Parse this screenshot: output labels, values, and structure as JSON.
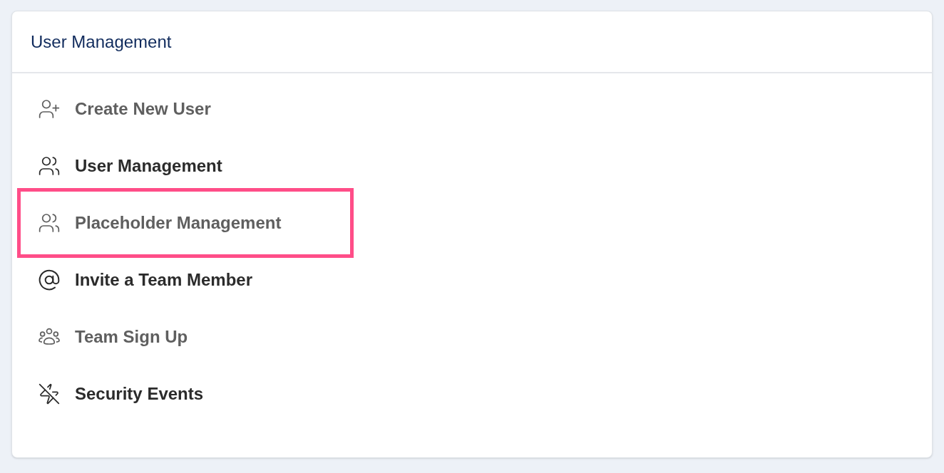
{
  "card": {
    "title": "User Management"
  },
  "menu": [
    {
      "label": "Create New User",
      "kind": "add-user",
      "dimmed": true,
      "highlighted": false
    },
    {
      "label": "User Management",
      "kind": "users",
      "dimmed": false,
      "highlighted": false
    },
    {
      "label": "Placeholder Management",
      "kind": "users",
      "dimmed": true,
      "highlighted": true
    },
    {
      "label": "Invite a Team Member",
      "kind": "invite",
      "dimmed": false,
      "highlighted": false
    },
    {
      "label": "Team Sign Up",
      "kind": "team",
      "dimmed": true,
      "highlighted": false
    },
    {
      "label": "Security Events",
      "kind": "security",
      "dimmed": false,
      "highlighted": false
    }
  ]
}
